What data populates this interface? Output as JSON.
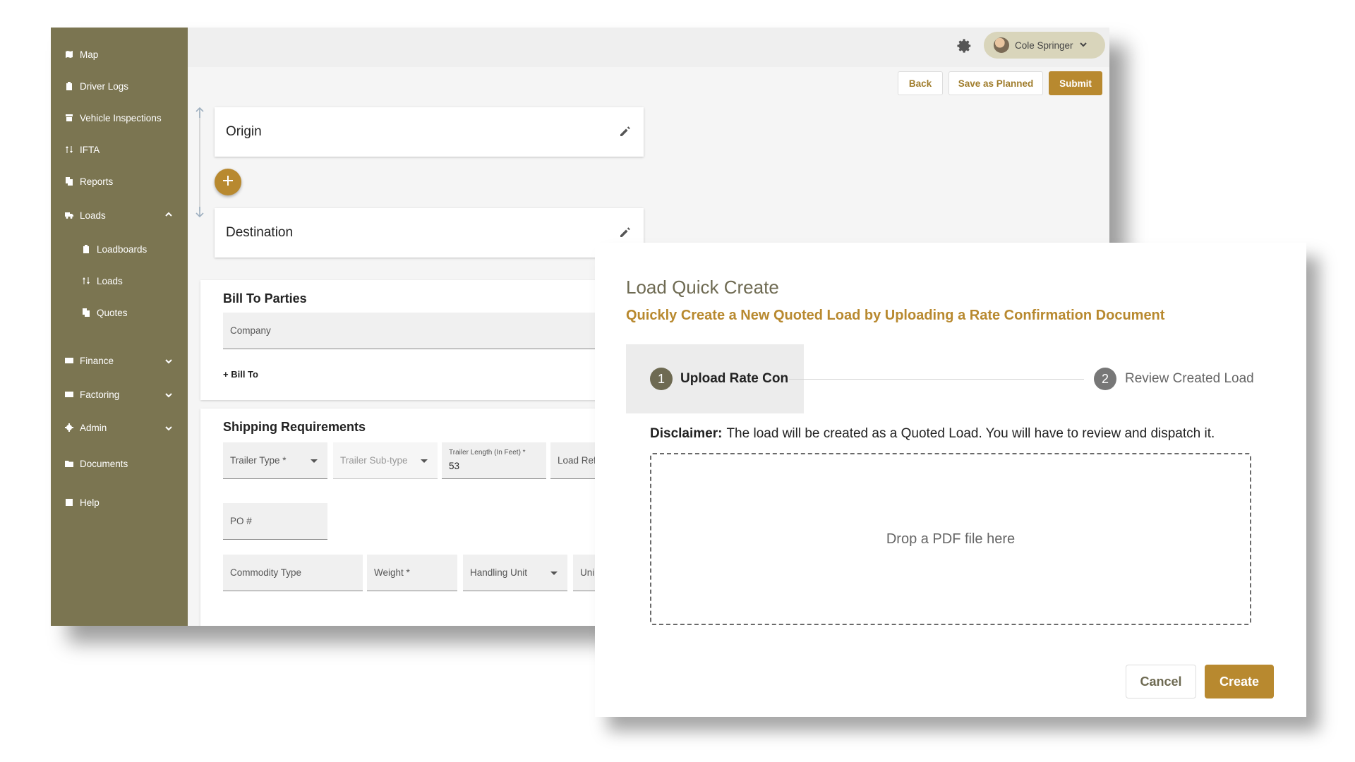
{
  "sidebar": {
    "items": [
      {
        "label": "Map",
        "icon": "map-icon"
      },
      {
        "label": "Driver Logs",
        "icon": "clipboard-icon"
      },
      {
        "label": "Vehicle Inspections",
        "icon": "archive-icon"
      },
      {
        "label": "IFTA",
        "icon": "swap-icon"
      },
      {
        "label": "Reports",
        "icon": "file-copy-icon"
      },
      {
        "label": "Loads",
        "icon": "truck-icon"
      },
      {
        "label": "Loadboards",
        "icon": "clipboard-icon"
      },
      {
        "label": "Loads",
        "icon": "swap-icon"
      },
      {
        "label": "Quotes",
        "icon": "file-copy-icon"
      },
      {
        "label": "Finance",
        "icon": "money-icon"
      },
      {
        "label": "Factoring",
        "icon": "money-icon"
      },
      {
        "label": "Admin",
        "icon": "gear-icon"
      },
      {
        "label": "Documents",
        "icon": "folder-icon"
      },
      {
        "label": "Help",
        "icon": "help-icon"
      }
    ]
  },
  "header": {
    "user_name": "Cole Springer",
    "back_label": "Back",
    "save_planned_label": "Save as Planned",
    "submit_label": "Submit"
  },
  "route": {
    "origin_label": "Origin",
    "destination_label": "Destination"
  },
  "bill_to": {
    "title": "Bill To Parties",
    "company_placeholder": "Company",
    "add_label": "+ Bill To"
  },
  "shipping": {
    "title": "Shipping Requirements",
    "trailer_type": "Trailer Type *",
    "trailer_subtype": "Trailer Sub-type",
    "trailer_length_label": "Trailer Length (In Feet) *",
    "trailer_length_value": "53",
    "load_ref": "Load Ref",
    "po": "PO #",
    "commodity_type": "Commodity Type",
    "weight": "Weight *",
    "handling_unit": "Handling Unit",
    "units": "Uni"
  },
  "modal": {
    "title": "Load Quick Create",
    "subtitle": "Quickly Create a New Quoted Load by Uploading a Rate Confirmation Document",
    "steps": [
      {
        "number": "1",
        "label": "Upload Rate Con"
      },
      {
        "number": "2",
        "label": "Review Created Load"
      }
    ],
    "disclaimer_label": "Disclaimer:",
    "disclaimer_text": "The load will be created as a Quoted Load. You will have to review and dispatch it.",
    "drop_text": "Drop a PDF file here",
    "cancel_label": "Cancel",
    "create_label": "Create"
  },
  "colors": {
    "sidebar_bg": "#7b7551",
    "accent_gold": "#b8892f",
    "olive_text": "#6e6a52"
  }
}
